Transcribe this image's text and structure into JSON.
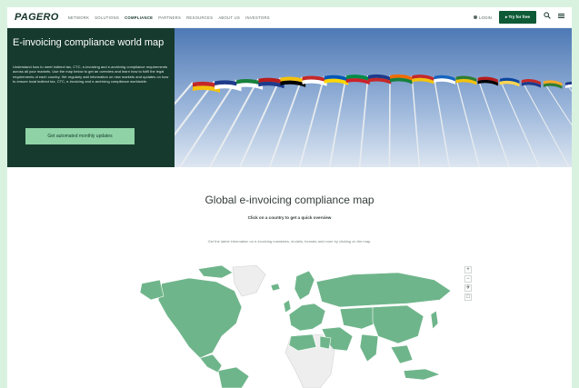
{
  "header": {
    "logo": "PAGERO",
    "nav": [
      "NETWORK",
      "SOLUTIONS",
      "COMPLIANCE",
      "PARTNERS",
      "RESOURCES",
      "ABOUT US",
      "INVESTORS"
    ],
    "active_nav": "COMPLIANCE",
    "login_label": "LOGIN",
    "try_label": "Try for free"
  },
  "hero": {
    "title": "E-invoicing compliance world map",
    "text": "Understand how to meet indirect tax, CTC, e-invoicing and e-archiving compliance requirements across all your markets. Use the map below to get an overview and learn how to fulfil the legal requirements of each country. We regularly add information on new markets and updates on how to ensure local indirect tax, CTC, e-invoicing and e-archiving compliance worldwide.",
    "cta_label": "Get automated monthly updates"
  },
  "map_section": {
    "title": "Global e-invoicing compliance map",
    "subtitle": "Click on a country to get a quick overview",
    "description": "Get the latest information on e-invoicing mandates, models, formats and more by clicking on the map."
  },
  "colors": {
    "brand_dark": "#163a2e",
    "cta_green": "#8ed2a5",
    "try_green": "#0e5a36",
    "map_green": "#6fb58b",
    "map_gray": "#eeeeee"
  }
}
